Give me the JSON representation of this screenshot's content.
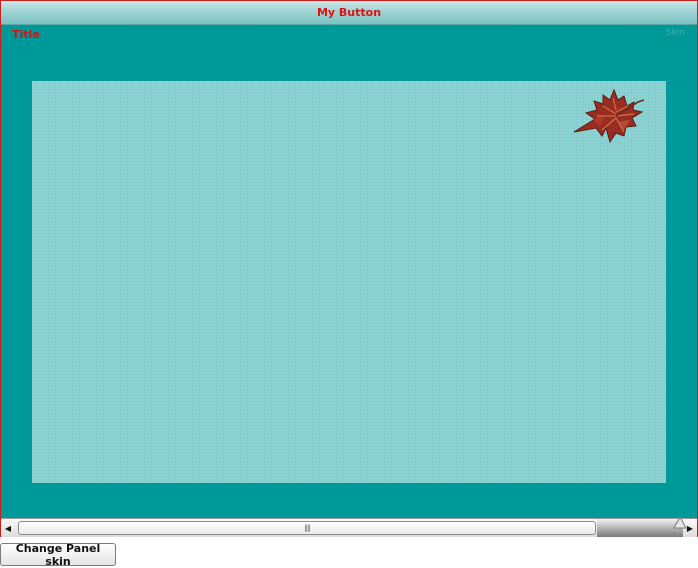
{
  "panel": {
    "header_button_label": "My Button",
    "title": "Title",
    "faint_label": "Skin"
  },
  "content": {
    "image_icon": "maple-leaf-icon"
  },
  "scrollbar": {
    "left_arrow": "◀",
    "right_arrow": "▶",
    "grip": "||||"
  },
  "footer": {
    "change_skin_label": "Change Panel skin"
  },
  "colors": {
    "panel_bg": "#009999",
    "content_bg": "#88d0d0",
    "accent_red": "#e01010",
    "border_red": "#c81e1e"
  }
}
